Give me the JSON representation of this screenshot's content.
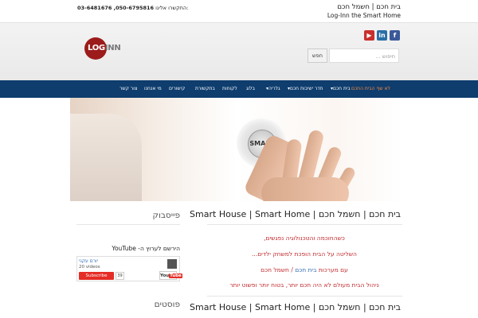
{
  "topbar": {
    "title": "בית חכם | חשמל חכם",
    "subtitle": "Log-Inn the Smart Home",
    "contact_label": "התקשרו אלינו:",
    "phones": "03-6481676 ,050-6795816"
  },
  "header": {
    "logo_text_red": "LOG",
    "logo_text_gray": "INN",
    "social": {
      "youtube": "▶",
      "linkedin": "in",
      "facebook": "f"
    },
    "search": {
      "placeholder": "חיפוש ...",
      "button": "חפש"
    }
  },
  "nav": {
    "items": [
      {
        "label": "לא שף הבית החכם",
        "active": true
      },
      {
        "label": "▾בית חכם"
      },
      {
        "label": "▾חדר ישיבות חכם"
      },
      {
        "label": "▾גלריה"
      },
      {
        "label": "בלוג"
      },
      {
        "label": "לקוחות"
      },
      {
        "label": "בתקשורת"
      },
      {
        "label": "קישורים"
      },
      {
        "label": "מי אנחנו"
      },
      {
        "label": "צור קשר"
      }
    ]
  },
  "hero": {
    "button_text": "SMART"
  },
  "main": {
    "title": "בית חכם | חשמל חכם | Smart House | Smart Home",
    "lines": [
      "כשהחוכמה והטכנולוגיה נפגשים,",
      "השליטה על הבית הופכת למשחק ילדים...",
      "ניהול הבית מעולם לא היה חכם יותר, בטוח יותר ופשוט יותר"
    ],
    "systems_prefix": "עם מערכות ",
    "systems_link1": "בית חכם",
    "systems_sep": " / ",
    "systems_link2": "חשמל חכם",
    "title_2": "בית חכם | חשמל חכם | Smart House | Smart Home"
  },
  "sidebar": {
    "facebook_title": "פייסבוק",
    "youtube_label": "הירשם לערוץ ה- YouTube",
    "youtube_channel": "יורם עקני",
    "youtube_videos": "20 videos",
    "youtube_subscribe": "Subscribe",
    "youtube_count": "39",
    "youtube_logo_you": "You",
    "youtube_logo_tube": "Tube",
    "posts_title": "פוסטים"
  },
  "colors": {
    "nav_bg": "#0e3d6e",
    "accent_red": "#c0282d",
    "link_blue": "#2e6db4",
    "nav_active": "#ff8a3d"
  }
}
